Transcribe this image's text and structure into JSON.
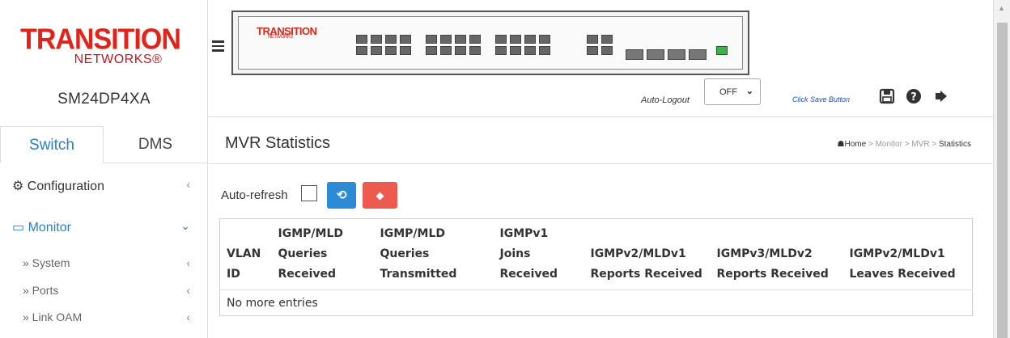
{
  "sidebar": {
    "logo_main": "TRANSITION",
    "logo_sub": "NETWORKS",
    "model": "SM24DP4XA",
    "tabs": [
      "Switch",
      "DMS"
    ],
    "menu": [
      {
        "label": "Configuration",
        "icon": "gear-icon"
      },
      {
        "label": "Monitor",
        "icon": "monitor-icon"
      }
    ],
    "submenu": [
      "» System",
      "» Ports",
      "» Link OAM"
    ]
  },
  "topbar": {
    "panel_logo": "TRANSITION",
    "panel_logo_sub": "NETWORKS",
    "auto_logout_label": "Auto-Logout",
    "auto_logout_value": "OFF",
    "save_hint": "Click Save Button"
  },
  "page": {
    "title": "MVR Statistics",
    "breadcrumb": [
      "Home",
      "Monitor",
      "MVR",
      "Statistics"
    ],
    "auto_refresh_label": "Auto-refresh",
    "table": {
      "headers": [
        "VLAN ID",
        "IGMP/MLD Queries Received",
        "IGMP/MLD Queries Transmitted",
        "IGMPv1 Joins Received",
        "IGMPv2/MLDv1 Reports Received",
        "IGMPv3/MLDv2 Reports Received",
        "IGMPv2/MLDv1 Leaves Received"
      ],
      "empty": "No more entries"
    }
  },
  "colors": {
    "brand": "#e2231a",
    "active": "#2a7fc1",
    "refresh": "#2c8bd6",
    "clear": "#ec5b4d"
  }
}
